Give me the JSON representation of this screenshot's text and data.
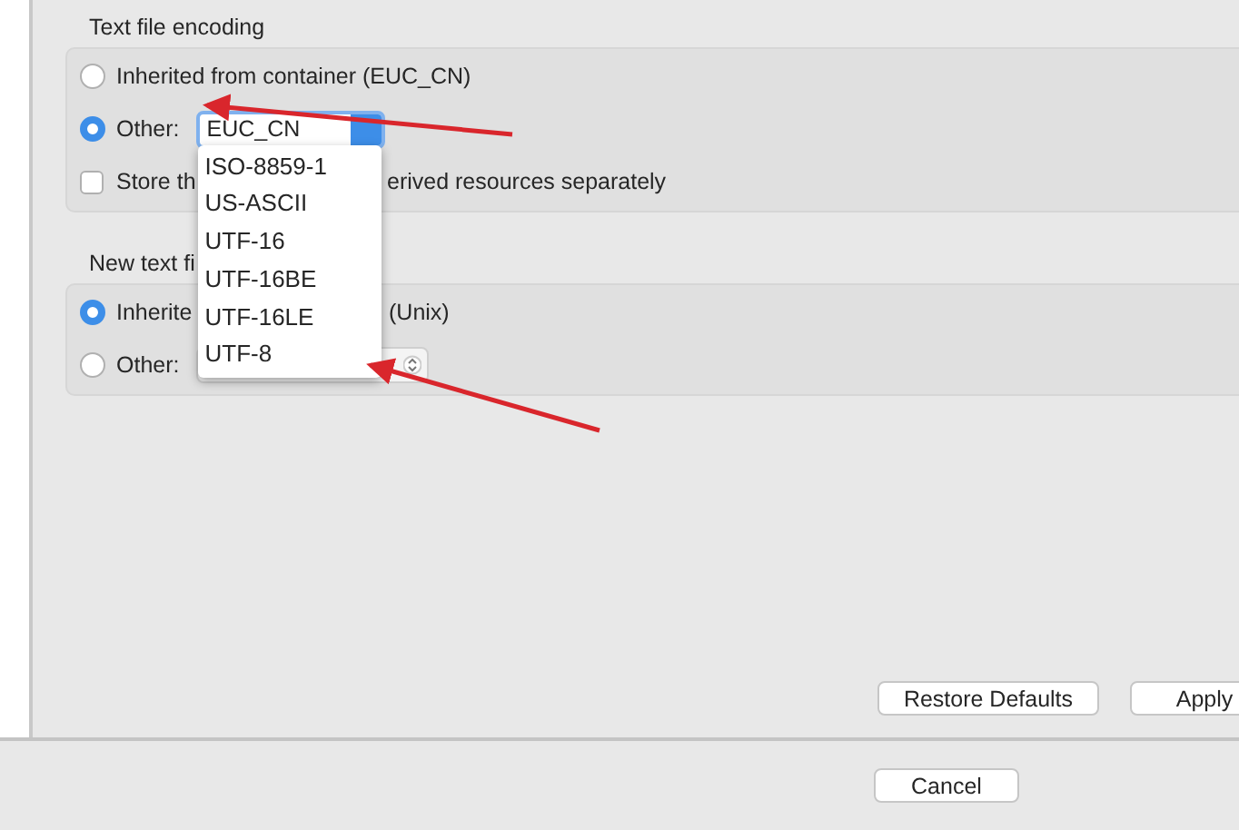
{
  "text_file_encoding": {
    "title": "Text file encoding",
    "options": [
      {
        "kind": "text",
        "label": "Inherited from container (EUC_CN)",
        "selected": false
      },
      {
        "kind": "combo",
        "label": "Other:",
        "value": "EUC_CN",
        "selected": true
      }
    ],
    "store_checkbox": {
      "label": "Store th",
      "label_after": "erived resources separately",
      "checked": false
    }
  },
  "new_text_file": {
    "title": "New text fi",
    "options": [
      {
        "kind": "split",
        "label": "Inherite",
        "label_after": "(Unix)",
        "selected": true
      },
      {
        "kind": "stepper",
        "label": "Other:",
        "selected": false
      }
    ]
  },
  "dropdown_options": [
    "ISO-8859-1",
    "US-ASCII",
    "UTF-16",
    "UTF-16BE",
    "UTF-16LE",
    "UTF-8"
  ],
  "buttons": [
    "Restore Defaults",
    "Apply"
  ],
  "footer_buttons": [
    "Cancel"
  ]
}
